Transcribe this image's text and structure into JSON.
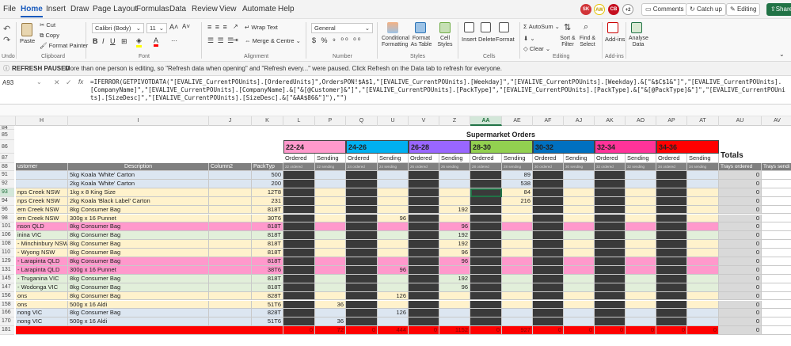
{
  "tabs": [
    "File",
    "Home",
    "Insert",
    "Draw",
    "Page Layout",
    "Formulas",
    "Data",
    "Review",
    "View",
    "Automate",
    "Help"
  ],
  "topbar": {
    "avatars": [
      "SK",
      "AW",
      "CB"
    ],
    "plus": "+2",
    "comments": "Comments",
    "catchup": "Catch up",
    "editing": "Editing",
    "share": "Share"
  },
  "ribbon": {
    "undo": "Undo",
    "paste": "Paste",
    "cut": "Cut",
    "copy": "Copy",
    "format_painter": "Format Painter",
    "clipboard": "Clipboard",
    "font_name": "Calibri (Body)",
    "font_size": "11",
    "font": "Font",
    "wrap": "Wrap Text",
    "merge": "Merge & Centre",
    "alignment": "Alignment",
    "numfmt": "General",
    "number": "Number",
    "cond": "Conditional Formatting",
    "fmt_table": "Format As Table",
    "cell_styles": "Cell Styles",
    "styles": "Styles",
    "insert": "Insert",
    "delete": "Delete",
    "format": "Format",
    "cells": "Cells",
    "autosum": "AutoSum",
    "clear": "Clear",
    "sort": "Sort & Filter",
    "find": "Find & Select",
    "editing": "Editing",
    "addins": "Add-ins",
    "addins_group": "Add-ins",
    "analyse": "Analyse Data"
  },
  "message": {
    "title": "REFRESH PAUSED",
    "text": "More than one person is editing, so \"Refresh data when opening\" and \"Refresh every...\" were paused. Click Refresh on the Data tab to refresh for everyone."
  },
  "namebox": "A93",
  "fx": "fx",
  "formula": "=IFERROR(GETPIVOTDATA(\"[EVALIVE_CurrentPOUnits].[OrderedUnits]\",OrdersPON!$A$1,\"[EVALIVE_CurrentPOUnits].[Weekday]\",\"[EVALIVE_CurrentPOUnits].[Weekday].&[\"&$C$1&\"]\",\"[EVALIVE_CurrentPOUnits].[CompanyName]\",\"[EVALIVE_CurrentPOUnits].[CompanyName].&[\"&[@Customer]&\"]\",\"[EVALIVE_CurrentPOUnits].[PackType]\",\"[EVALIVE_CurrentPOUnits].[PackType].&[\"&[@PackType]&\"]\",\"[EVALIVE_CurrentPOUnits].[SizeDesc]\",\"[EVALIVE_CurrentPOUnits].[SizeDesc].&[\"&AA$86&\"]\"),\"\")",
  "columns": [
    "H",
    "I",
    "J",
    "K",
    "L",
    "P",
    "Q",
    "U",
    "V",
    "Z",
    "AA",
    "AE",
    "AF",
    "AJ",
    "AK",
    "AO",
    "AP",
    "AT",
    "AU",
    "AV"
  ],
  "sheet": {
    "title": "Supermarket Orders",
    "sizes": [
      "22-24",
      "24-26",
      "26-28",
      "28-30",
      "30-32",
      "32-34",
      "34-36"
    ],
    "size_colors": [
      "#ff99cc",
      "#00b0f0",
      "#9966ff",
      "#92d050",
      "#0070c0",
      "#ff3399",
      "#ff0000"
    ],
    "totals": "Totals",
    "ordered": "Ordered",
    "sending": "Sending",
    "hdr_customer": "ustomer",
    "hdr_desc": "Description",
    "hdr_col2": "Column2",
    "hdr_pack": "PackTyp",
    "small_labels": [
      "22 ordered",
      "22 sending",
      "24 ordered",
      "24 sending",
      "26 ordered",
      "26 sending",
      "28 ordered",
      "28 sending",
      "30 ordered",
      "30 sending",
      "32 ordered",
      "32 sending",
      "34 ordered",
      "34 sending"
    ],
    "trays_ordered": "Trays ordered",
    "trays_sending": "Trays sendi"
  },
  "row_numbers_top": [
    "84",
    "85",
    "86",
    "87",
    "88"
  ],
  "rows": [
    {
      "n": "91",
      "customer": "",
      "desc": "5kg Koala 'White' Carton",
      "col2": "",
      "pack": "500",
      "fill": "#dce6f1",
      "vals": {
        "AE": "89"
      },
      "total": "0"
    },
    {
      "n": "92",
      "customer": "",
      "desc": "2kg Koala 'White' Carton",
      "col2": "",
      "pack": "200",
      "fill": "#dce6f1",
      "vals": {
        "AE": "538"
      },
      "total": "0"
    },
    {
      "n": "93",
      "customer": "nps Creek NSW",
      "desc": "1kg x 8 King Size",
      "col2": "",
      "pack": "12T8",
      "fill": "#fff2cc",
      "vals": {
        "AE": "84"
      },
      "total": "0"
    },
    {
      "n": "94",
      "customer": "nps Creek NSW",
      "desc": "2kg Koala 'Black Label' Carton",
      "col2": "",
      "pack": "231",
      "fill": "#fff2cc",
      "vals": {
        "AE": "216"
      },
      "total": "0"
    },
    {
      "n": "96",
      "customer": "ern Creek NSW",
      "desc": "8kg Consumer Bag",
      "col2": "",
      "pack": "818T",
      "fill": "#fff2cc",
      "vals": {
        "Z": "192"
      },
      "total": "0"
    },
    {
      "n": "98",
      "customer": "ern Creek NSW",
      "desc": "300g x 16 Punnet",
      "col2": "",
      "pack": "30T6",
      "fill": "#fff2cc",
      "vals": {
        "U": "96"
      },
      "total": "0"
    },
    {
      "n": "101",
      "customer": "nson QLD",
      "desc": "8kg Consumer Bag",
      "col2": "",
      "pack": "818T",
      "fill": "#ff99cc",
      "vals": {
        "Z": "96"
      },
      "total": "0"
    },
    {
      "n": "106",
      "customer": "inina VIC",
      "desc": "8kg Consumer Bag",
      "col2": "",
      "pack": "818T",
      "fill": "#e2efda",
      "vals": {
        "Z": "192"
      },
      "total": "0"
    },
    {
      "n": "108",
      "customer": "- Minchinbury NSW",
      "desc": "8kg Consumer Bag",
      "col2": "",
      "pack": "818T",
      "fill": "#fff2cc",
      "vals": {
        "Z": "192"
      },
      "total": "0"
    },
    {
      "n": "110",
      "customer": "- Wyong NSW",
      "desc": "8kg Consumer Bag",
      "col2": "",
      "pack": "818T",
      "fill": "#fff2cc",
      "vals": {
        "Z": "96"
      },
      "total": "0"
    },
    {
      "n": "129",
      "customer": "- Larapinta QLD",
      "desc": "8kg Consumer Bag",
      "col2": "",
      "pack": "818T",
      "fill": "#ff99cc",
      "vals": {
        "Z": "96"
      },
      "total": "0"
    },
    {
      "n": "131",
      "customer": "- Larapinta QLD",
      "desc": "300g x 16 Punnet",
      "col2": "",
      "pack": "38T6",
      "fill": "#ff99cc",
      "vals": {
        "U": "96"
      },
      "total": "0"
    },
    {
      "n": "145",
      "customer": "- Truganina VIC",
      "desc": "8kg Consumer Bag",
      "col2": "",
      "pack": "818T",
      "fill": "#e2efda",
      "vals": {
        "Z": "192"
      },
      "total": "0"
    },
    {
      "n": "147",
      "customer": "- Wodonga VIC",
      "desc": "8kg Consumer Bag",
      "col2": "",
      "pack": "818T",
      "fill": "#e2efda",
      "vals": {
        "Z": "96"
      },
      "total": "0"
    },
    {
      "n": "156",
      "customer": "ons",
      "desc": "8kg Consumer Bag",
      "col2": "",
      "pack": "828T",
      "fill": "#fff2cc",
      "vals": {
        "U": "126"
      },
      "total": "0"
    },
    {
      "n": "158",
      "customer": "ons",
      "desc": "500g x 16 Aldi",
      "col2": "",
      "pack": "51T6",
      "fill": "#fff2cc",
      "vals": {
        "P": "36"
      },
      "total": "0"
    },
    {
      "n": "166",
      "customer": "nong VIC",
      "desc": "8kg Consumer Bag",
      "col2": "",
      "pack": "828T",
      "fill": "#dce6f1",
      "vals": {
        "U": "126"
      },
      "total": "0"
    },
    {
      "n": "170",
      "customer": "nong VIC",
      "desc": "500g x 16 Aldi",
      "col2": "",
      "pack": "51T6",
      "fill": "#dce6f1",
      "vals": {
        "P": "36"
      },
      "total": "0"
    }
  ],
  "total_row": {
    "n": "181",
    "vals": {
      "L": "0",
      "P": "72",
      "Q": "0",
      "U": "444",
      "V": "0",
      "Z": "1152",
      "AA": "0",
      "AE": "927",
      "AF": "0",
      "AJ": "0",
      "AK": "0",
      "AO": "0",
      "AP": "0",
      "AT": "0"
    },
    "total": "0"
  }
}
